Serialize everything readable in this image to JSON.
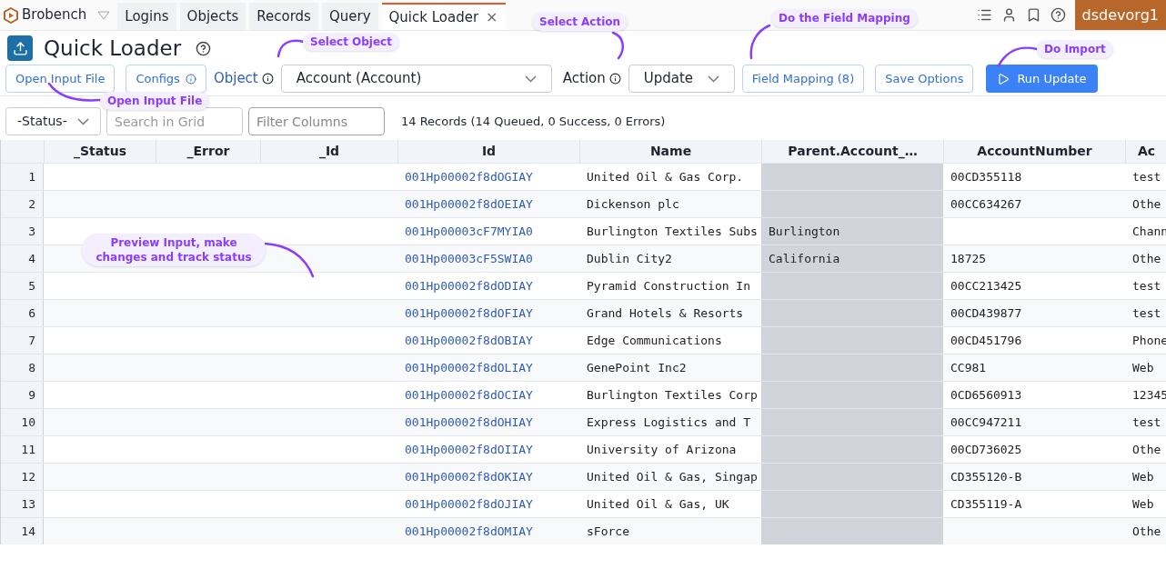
{
  "app": {
    "name": "Brobench"
  },
  "tabs": [
    {
      "label": "Logins",
      "selected": false
    },
    {
      "label": "Objects",
      "selected": false
    },
    {
      "label": "Records",
      "selected": false
    },
    {
      "label": "Query",
      "selected": false
    },
    {
      "label": "Quick Loader",
      "selected": true,
      "close": "×"
    }
  ],
  "org": "dsdevorg1",
  "page": {
    "title": "Quick Loader"
  },
  "toolbar": {
    "open_file": "Open Input File",
    "configs": "Configs",
    "object_label": "Object",
    "object_value": "Account (Account)",
    "action_label": "Action",
    "action_value": "Update",
    "field_mapping": "Field Mapping (8)",
    "save_options": "Save Options",
    "run": "Run Update"
  },
  "filters": {
    "status": "-Status-",
    "search_placeholder": "Search in Grid",
    "filter_placeholder": "Filter Columns",
    "summary": "14 Records (14 Queued, 0 Success, 0 Errors)"
  },
  "table": {
    "columns": [
      {
        "label": "_Status",
        "kind": "plain"
      },
      {
        "label": "_Error",
        "kind": "plain"
      },
      {
        "label": "_Id",
        "kind": "plain"
      },
      {
        "label": "Id",
        "kind": "link"
      },
      {
        "label": "Name",
        "kind": "plain"
      },
      {
        "label": "Parent.Account_…",
        "kind": "readonly"
      },
      {
        "label": "AccountNumber",
        "kind": "plain"
      },
      {
        "label": "Ac",
        "kind": "plain"
      }
    ],
    "rows": [
      {
        "num": "1",
        "id": "001Hp00002f8dOGIAY",
        "name": "United Oil & Gas Corp.",
        "account_number": "00CD355118",
        "column_9": "test"
      },
      {
        "num": "2",
        "id": "001Hp00002f8dOEIAY",
        "name": "Dickenson plc",
        "account_number": "00CC634267",
        "column_9": "Othe"
      },
      {
        "num": "3",
        "id": "001Hp00003cF7MYIA0",
        "name": "Burlington Textiles Subs",
        "parent": "Burlington",
        "column_9": "Chann"
      },
      {
        "num": "4",
        "id": "001Hp00003cF5SWIA0",
        "name": "Dublin City2",
        "parent": "California",
        "account_number": "18725",
        "column_9": "Othe"
      },
      {
        "num": "5",
        "id": "001Hp00002f8dODIAY",
        "name": "Pyramid Construction In",
        "account_number": "00CC213425",
        "column_9": "test"
      },
      {
        "num": "6",
        "id": "001Hp00002f8dOFIAY",
        "name": "Grand Hotels & Resorts",
        "account_number": "00CD439877",
        "column_9": "test"
      },
      {
        "num": "7",
        "id": "001Hp00002f8dOBIAY",
        "name": "Edge Communications",
        "account_number": "00CD451796",
        "column_9": "Phone"
      },
      {
        "num": "8",
        "id": "001Hp00002f8dOLIAY",
        "name": "GenePoint Inc2",
        "account_number": "CC981",
        "column_9": "Web"
      },
      {
        "num": "9",
        "id": "001Hp00002f8dOCIAY",
        "name": "Burlington Textiles Corp",
        "account_number": "0CD6560913",
        "column_9": "12345"
      },
      {
        "num": "10",
        "id": "001Hp00002f8dOHIAY",
        "name": "Express Logistics and T",
        "account_number": "00CC947211",
        "column_9": "test"
      },
      {
        "num": "11",
        "id": "001Hp00002f8dOIIAY",
        "name": "University of Arizona",
        "account_number": "00CD736025",
        "column_9": "Othe"
      },
      {
        "num": "12",
        "id": "001Hp00002f8dOKIAY",
        "name": "United Oil & Gas, Singap",
        "account_number": "CD355120-B",
        "column_9": "Web"
      },
      {
        "num": "13",
        "id": "001Hp00002f8dOJIAY",
        "name": "United Oil & Gas, UK",
        "account_number": "CD355119-A",
        "column_9": "Web"
      },
      {
        "num": "14",
        "id": "001Hp00002f8dOMIAY",
        "name": "sForce",
        "column_9": "Othe"
      }
    ]
  },
  "annotations": [
    {
      "text": "Select Object"
    },
    {
      "text": "Open Input File"
    },
    {
      "text": "Select Action"
    },
    {
      "text": "Do the Field Mapping"
    },
    {
      "text": "Do Import"
    },
    {
      "text": "Preview Input, make changes and track status"
    }
  ]
}
